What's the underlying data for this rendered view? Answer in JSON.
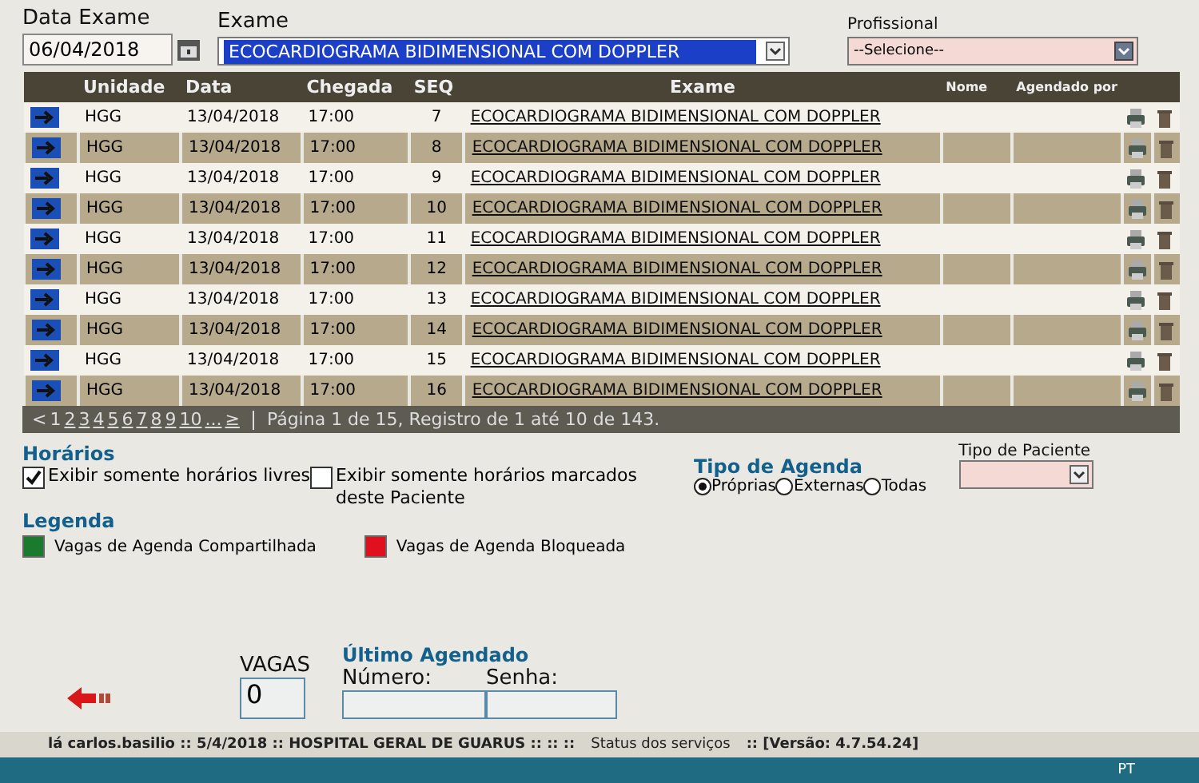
{
  "filters": {
    "data_exame": {
      "label": "Data Exame",
      "value": "06/04/2018"
    },
    "exame": {
      "label": "Exame",
      "value": "ECOCARDIOGRAMA BIDIMENSIONAL COM DOPPLER"
    },
    "profissional": {
      "label": "Profissional",
      "value": "--Selecione--"
    }
  },
  "table": {
    "columns": [
      "Unidade",
      "Data",
      "Chegada",
      "SEQ",
      "Exame",
      "Nome",
      "Agendado por"
    ],
    "rows": [
      {
        "unidade": "HGG",
        "data": "13/04/2018",
        "chegada": "17:00",
        "seq": "7",
        "exame": "ECOCARDIOGRAMA BIDIMENSIONAL COM DOPPLER"
      },
      {
        "unidade": "HGG",
        "data": "13/04/2018",
        "chegada": "17:00",
        "seq": "8",
        "exame": "ECOCARDIOGRAMA BIDIMENSIONAL COM DOPPLER"
      },
      {
        "unidade": "HGG",
        "data": "13/04/2018",
        "chegada": "17:00",
        "seq": "9",
        "exame": "ECOCARDIOGRAMA BIDIMENSIONAL COM DOPPLER"
      },
      {
        "unidade": "HGG",
        "data": "13/04/2018",
        "chegada": "17:00",
        "seq": "10",
        "exame": "ECOCARDIOGRAMA BIDIMENSIONAL COM DOPPLER"
      },
      {
        "unidade": "HGG",
        "data": "13/04/2018",
        "chegada": "17:00",
        "seq": "11",
        "exame": "ECOCARDIOGRAMA BIDIMENSIONAL COM DOPPLER"
      },
      {
        "unidade": "HGG",
        "data": "13/04/2018",
        "chegada": "17:00",
        "seq": "12",
        "exame": "ECOCARDIOGRAMA BIDIMENSIONAL COM DOPPLER"
      },
      {
        "unidade": "HGG",
        "data": "13/04/2018",
        "chegada": "17:00",
        "seq": "13",
        "exame": "ECOCARDIOGRAMA BIDIMENSIONAL COM DOPPLER"
      },
      {
        "unidade": "HGG",
        "data": "13/04/2018",
        "chegada": "17:00",
        "seq": "14",
        "exame": "ECOCARDIOGRAMA BIDIMENSIONAL COM DOPPLER"
      },
      {
        "unidade": "HGG",
        "data": "13/04/2018",
        "chegada": "17:00",
        "seq": "15",
        "exame": "ECOCARDIOGRAMA BIDIMENSIONAL COM DOPPLER"
      },
      {
        "unidade": "HGG",
        "data": "13/04/2018",
        "chegada": "17:00",
        "seq": "16",
        "exame": "ECOCARDIOGRAMA BIDIMENSIONAL COM DOPPLER"
      }
    ]
  },
  "pagination": {
    "prev": "<",
    "pages": [
      {
        "label": "1",
        "selected": true
      },
      {
        "label": "2",
        "selected": false
      },
      {
        "label": "3",
        "selected": false
      },
      {
        "label": "4",
        "selected": false
      },
      {
        "label": "5",
        "selected": false
      },
      {
        "label": "6",
        "selected": false
      },
      {
        "label": "7",
        "selected": false
      },
      {
        "label": "8",
        "selected": false
      },
      {
        "label": "9",
        "selected": false
      },
      {
        "label": "10",
        "selected": false
      }
    ],
    "more": "...",
    "next": "≥",
    "info": "Página 1 de 15, Registro de 1 até 10 de 143."
  },
  "horarios": {
    "title": "Horários",
    "options": [
      {
        "label": "Exibir somente horários livres",
        "checked": true
      },
      {
        "label": "Exibir somente horários marcados deste Paciente",
        "checked": false
      }
    ]
  },
  "tipo_agenda": {
    "title": "Tipo de Agenda",
    "options": [
      {
        "label": "Próprias",
        "selected": true
      },
      {
        "label": "Externas",
        "selected": false
      },
      {
        "label": "Todas",
        "selected": false
      }
    ]
  },
  "tipo_paciente": {
    "label": "Tipo de Paciente"
  },
  "legenda": {
    "title": "Legenda",
    "items": [
      {
        "label": "Vagas de Agenda Compartilhada",
        "color": "#1a7a2e"
      },
      {
        "label": "Vagas de Agenda Bloqueada",
        "color": "#e0101e"
      }
    ]
  },
  "vagas": {
    "label": "VAGAS",
    "value": "0"
  },
  "ultimo_agendado": {
    "title": "Último Agendado",
    "numero_label": "Número:",
    "senha_label": "Senha:"
  },
  "status_bar": {
    "text": "lá carlos.basilio :: 5/4/2018 :: HOSPITAL GERAL DE GUARUS :: :: ::",
    "services": "Status dos serviços",
    "version": ":: [Versão: 4.7.54.24]"
  },
  "taskbar": {
    "language": "PT"
  }
}
